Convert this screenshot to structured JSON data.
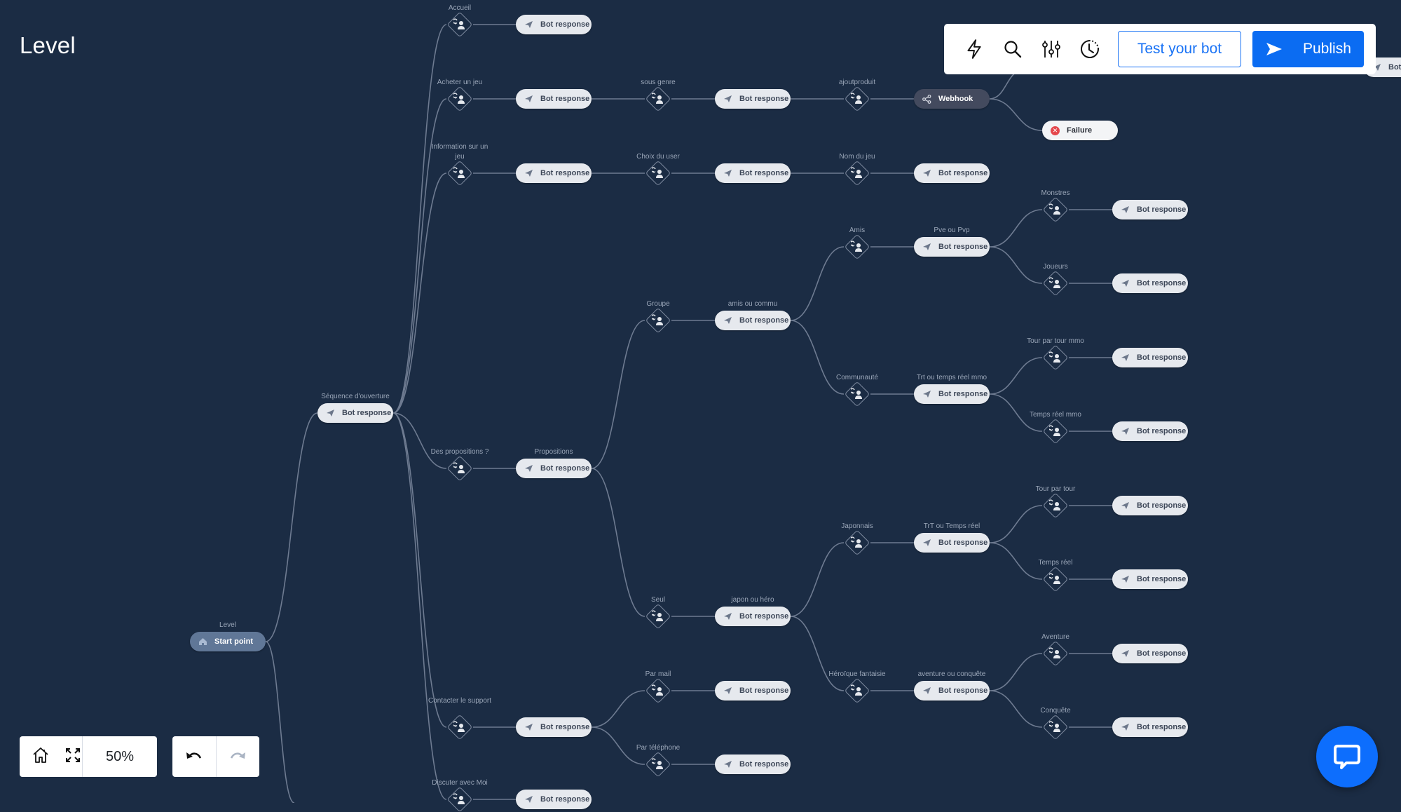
{
  "page": {
    "title": "Level"
  },
  "toolbar": {
    "icons": [
      "lightning-icon",
      "search-icon",
      "sliders-icon",
      "history-icon"
    ],
    "test_label": "Test your bot",
    "publish_label": "Publish",
    "accent_color": "#0b6cf2"
  },
  "zoom_controls": {
    "zoom_level": "50%",
    "home_icon": "home-icon",
    "fit_icon": "fullscreen-icon"
  },
  "history_controls": {
    "undo_icon": "undo-icon",
    "redo_icon": "redo-icon",
    "redo_enabled": false
  },
  "chat_widget": {
    "icon": "chat-bubble-icon"
  },
  "flow": {
    "start": {
      "label": "Level",
      "text": "Start point"
    },
    "opening": {
      "label": "Séquence d'ouverture",
      "text": "Bot response"
    },
    "intents": [
      {
        "id": "accueil",
        "label": "Accueil",
        "response": "Bot response"
      },
      {
        "id": "acheter",
        "label": "Acheter un jeu",
        "response": "Bot response",
        "children": [
          {
            "id": "sous-genre",
            "label": "sous genre",
            "response": "Bot response",
            "children": [
              {
                "id": "ajoutproduit",
                "label": "ajoutproduit",
                "webhook": "Webhook",
                "failure": "Failure"
              }
            ]
          }
        ]
      },
      {
        "id": "info",
        "label": "Information sur un jeu",
        "response": "Bot response",
        "children": [
          {
            "id": "choix-user",
            "label": "Choix du user",
            "response": "Bot response",
            "children": [
              {
                "id": "nom-jeu",
                "label": "Nom du jeu",
                "response": "Bot response"
              }
            ]
          }
        ]
      },
      {
        "id": "des-propositions",
        "label": "Des propositions ?",
        "response_label": "Propositions",
        "response": "Bot response",
        "children": [
          {
            "id": "groupe",
            "label": "Groupe",
            "response_label": "amis ou commu",
            "response": "Bot response",
            "children": [
              {
                "id": "amis",
                "label": "Amis",
                "response_label": "Pve ou Pvp",
                "response": "Bot response",
                "children": [
                  {
                    "label": "Monstres",
                    "response": "Bot response"
                  },
                  {
                    "label": "Joueurs",
                    "response": "Bot response"
                  }
                ]
              },
              {
                "id": "communaute",
                "label": "Communauté",
                "response_label": "Trt ou temps réel mmo",
                "response": "Bot response",
                "children": [
                  {
                    "label": "Tour par tour mmo",
                    "response": "Bot response"
                  },
                  {
                    "label": "Temps réel mmo",
                    "response": "Bot response"
                  }
                ]
              }
            ]
          },
          {
            "id": "seul",
            "label": "Seul",
            "response_label": "japon ou héro",
            "response": "Bot response",
            "children": [
              {
                "id": "japonnais",
                "label": "Japonnais",
                "response_label": "TrT ou Temps réel",
                "response": "Bot response",
                "children": [
                  {
                    "label": "Tour par tour",
                    "response": "Bot response"
                  },
                  {
                    "label": "Temps réel",
                    "response": "Bot response"
                  }
                ]
              },
              {
                "id": "heroique",
                "label": "Héroïque fantaisie",
                "response_label": "aventure ou conquête",
                "response": "Bot response",
                "children": [
                  {
                    "label": "Aventure",
                    "response": "Bot response"
                  },
                  {
                    "label": "Conquête",
                    "response": "Bot response"
                  }
                ]
              }
            ]
          }
        ]
      },
      {
        "id": "support",
        "label": "Contacter le support",
        "response": "Bot response",
        "children": [
          {
            "label": "Par mail",
            "response": "Bot response"
          },
          {
            "label": "Par téléphone",
            "response": "Bot response"
          }
        ]
      },
      {
        "id": "discuter",
        "label": "Discuter avec Moi",
        "response": "Bot response"
      }
    ],
    "offscreen_partial": {
      "text": "Bot"
    }
  }
}
